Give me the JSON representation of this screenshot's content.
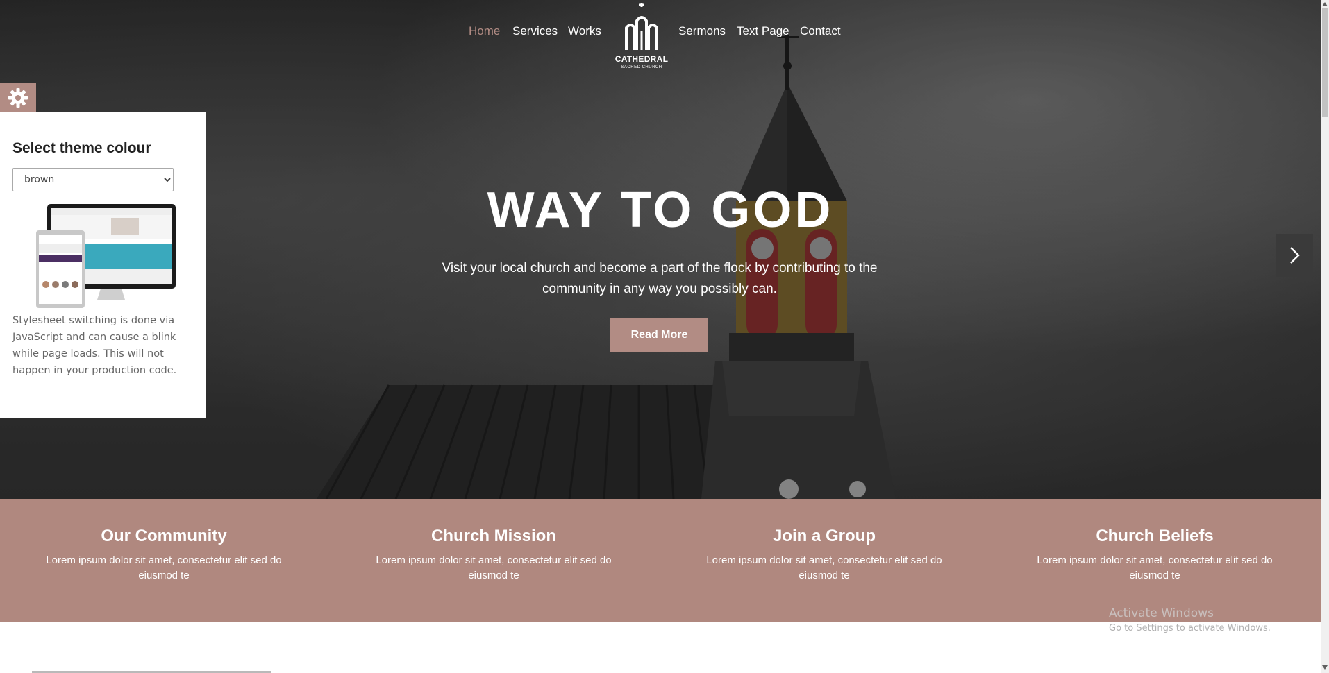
{
  "nav": {
    "items": [
      {
        "label": "Home",
        "active": true
      },
      {
        "label": "Services"
      },
      {
        "label": "Works"
      },
      {
        "label": "Sermons"
      },
      {
        "label": "Text Page"
      },
      {
        "label": "Contact"
      }
    ],
    "logo": {
      "name": "CATHEDRAL",
      "tagline": "SACRED CHURCH",
      "icon": "cathedral-icon"
    }
  },
  "hero": {
    "title": "WAY TO GOD",
    "text": "Visit your local church and become a part of the flock by contributing to the community in any way you possibly can.",
    "button_label": "Read More",
    "next_icon": "chevron-right-icon"
  },
  "theme_panel": {
    "toggle_icon": "gear-icon",
    "title": "Select theme colour",
    "selected": "brown",
    "note": "Stylesheet switching is done via JavaScript and can cause a blink while page loads. This will not happen in your production code."
  },
  "features": [
    {
      "title": "Our Community",
      "text": "Lorem ipsum dolor sit amet, consectetur elit sed do eiusmod te"
    },
    {
      "title": "Church Mission",
      "text": "Lorem ipsum dolor sit amet, consectetur elit sed do eiusmod te"
    },
    {
      "title": "Join a Group",
      "text": "Lorem ipsum dolor sit amet, consectetur elit sed do eiusmod te"
    },
    {
      "title": "Church Beliefs",
      "text": "Lorem ipsum dolor sit amet, consectetur elit sed do eiusmod te"
    }
  ],
  "watermark": {
    "title": "Activate Windows",
    "subtitle": "Go to Settings to activate Windows."
  },
  "colors": {
    "accent": "#b28c84",
    "features_bg": "#b0887f",
    "hero_bg": "#333333"
  }
}
